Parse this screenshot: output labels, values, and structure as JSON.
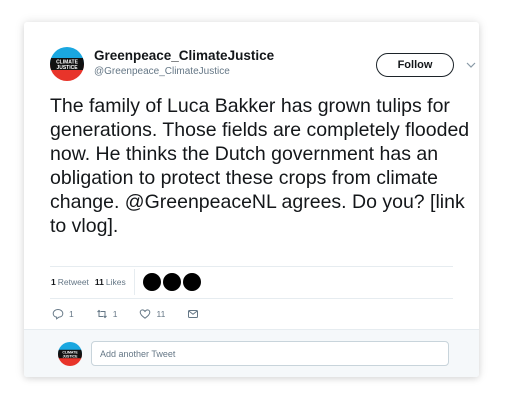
{
  "tweet": {
    "display_name": "Greenpeace_ClimateJustice",
    "handle": "@Greenpeace_ClimateJustice",
    "avatar_text_top": "CLIMATE",
    "avatar_text_bottom": "JUSTICE",
    "avatar_colors": {
      "top": "#1aa7e0",
      "bottom": "#e8342a",
      "band": "#111111"
    },
    "follow_label": "Follow",
    "text": "The family of Luca Bakker has grown tulips for generations. Those fields are completely flooded now. He thinks the Dutch government has an obligation to protect these crops from climate change. @GreenpeaceNL agrees. Do you? [link to vlog]."
  },
  "stats": {
    "retweet_count": "1",
    "retweet_label": "Retweet",
    "like_count": "11",
    "like_label": "Likes"
  },
  "actions": {
    "reply_count": "1",
    "retweet_count": "1",
    "like_count": "11",
    "icons": [
      "reply-icon",
      "retweet-icon",
      "like-icon",
      "message-icon"
    ]
  },
  "reply": {
    "placeholder": "Add another Tweet"
  }
}
